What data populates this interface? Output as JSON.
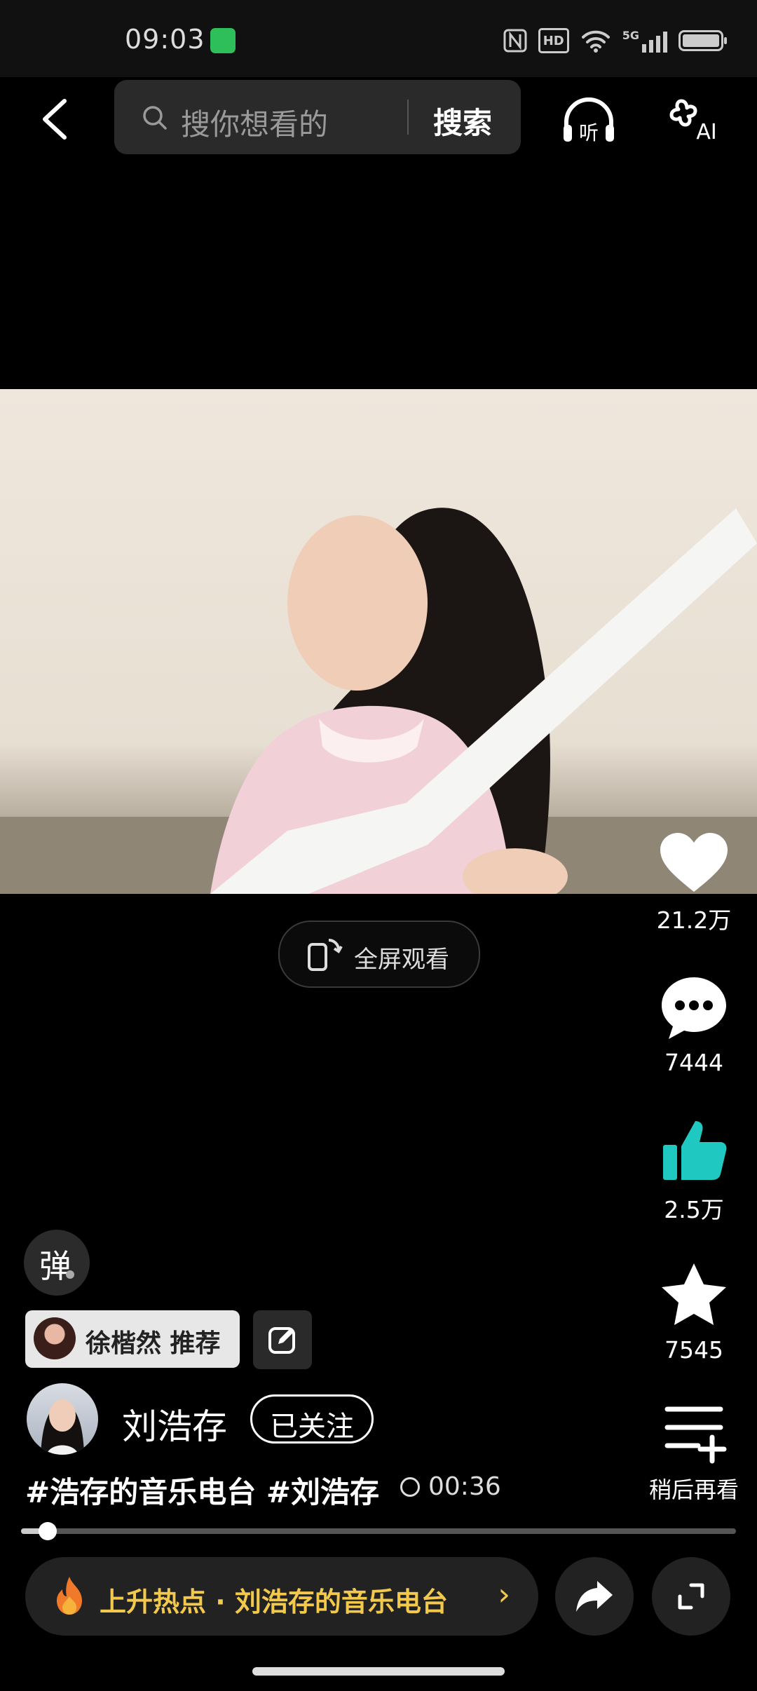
{
  "status_bar": {
    "time": "09:03",
    "hd": "HD",
    "net": "5G"
  },
  "search": {
    "placeholder": "搜你想看的",
    "button": "搜索"
  },
  "header": {
    "listen_label": "听",
    "ai_label": "AI"
  },
  "fullscreen": {
    "label": "全屏观看"
  },
  "actions": [
    {
      "id": "like",
      "count": "21.2万"
    },
    {
      "id": "comment",
      "count": "7444"
    },
    {
      "id": "thumb",
      "count": "2.5万"
    },
    {
      "id": "favorite",
      "count": "7545"
    },
    {
      "id": "later",
      "count": "稍后再看"
    }
  ],
  "danmu": {
    "label": "弹"
  },
  "recommend": {
    "text": "徐楷然 推荐"
  },
  "author": {
    "name": "刘浩存",
    "follow_label": "已关注"
  },
  "video": {
    "tags": "#浩存的音乐电台 #刘浩存",
    "duration": "00:36",
    "progress": 0.037
  },
  "hot": {
    "text": "上升热点 · 刘浩存的音乐电台",
    "arrow": "›"
  },
  "colors": {
    "accent_teal": "#1fc8c0",
    "hot_text": "#f2c94c",
    "background": "#000000"
  }
}
